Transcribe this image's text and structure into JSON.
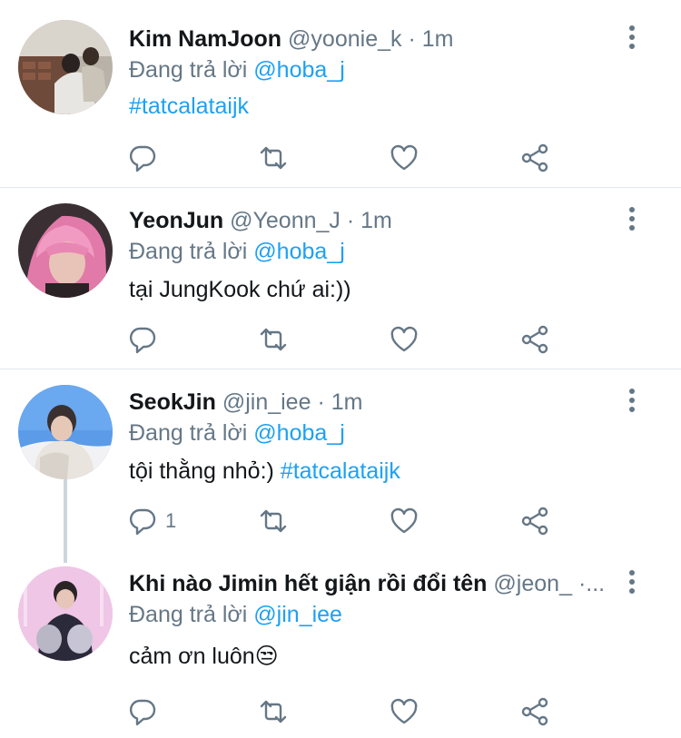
{
  "tweets": [
    {
      "name": "Kim NamJoon",
      "handle": "@yoonie_k",
      "dot": "·",
      "time": "1m",
      "reply_prefix": "Đang trả lời",
      "reply_to": "@hoba_j",
      "text_plain": "",
      "text_tag": "#tatcalataijk",
      "reply_count": "",
      "avatar_icon": "avatar-photo"
    },
    {
      "name": "YeonJun",
      "handle": "@Yeonn_J",
      "dot": "·",
      "time": "1m",
      "reply_prefix": "Đang trả lời",
      "reply_to": "@hoba_j",
      "text_plain": "tại JungKook chứ ai:))",
      "text_tag": "",
      "reply_count": "",
      "avatar_icon": "avatar-photo"
    },
    {
      "name": "SeokJin",
      "handle": "@jin_iee",
      "dot": "·",
      "time": "1m",
      "reply_prefix": "Đang trả lời",
      "reply_to": "@hoba_j",
      "text_plain": "tội thằng nhỏ:) ",
      "text_tag": "#tatcalataijk",
      "reply_count": "1",
      "avatar_icon": "avatar-photo"
    },
    {
      "name": "Khi nào Jimin hết giận rồi đổi tên",
      "handle": "@jeon_",
      "dot": "·...",
      "time": "",
      "reply_prefix": "Đang trả lời",
      "reply_to": "@jin_iee",
      "text_plain": "cảm ơn luôn😒",
      "text_tag": "",
      "reply_count": "",
      "avatar_icon": "avatar-photo"
    }
  ],
  "icons": {
    "reply": "reply-icon",
    "retweet": "retweet-icon",
    "like": "heart-icon",
    "share": "share-icon",
    "more": "more-icon"
  },
  "colors": {
    "link": "#1da1f2",
    "muted": "#657786",
    "separator": "#e1e8ed"
  }
}
